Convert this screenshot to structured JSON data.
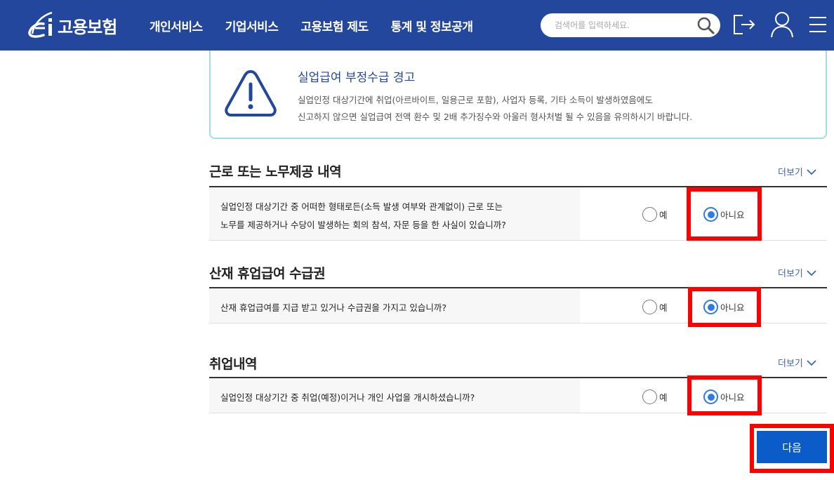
{
  "header": {
    "logo_text": "고용보험",
    "nav": [
      "개인서비스",
      "기업서비스",
      "고용보험 제도",
      "통계 및 정보공개"
    ],
    "search_placeholder": "검색어를 입력하세요.",
    "bg_color": "#23479c"
  },
  "alert": {
    "title": "실업급여 부정수급 경고",
    "line1": "실업인정 대상기간에 취업(아르바이트, 일용근로 포함), 사업자 등록, 기타 소득이 발생하였음에도",
    "line2": "신고하지 않으면 실업급여 전액 환수 및 2배 추가징수와 아울러 형사처벌 될 수 있음을 유의하시기 바랍니다."
  },
  "sections": [
    {
      "title": "근로 또는 노무제공 내역",
      "more": "더보기",
      "question_lines": [
        "실업인정 대상기간 중 어떠한 형태로든(소득 발생 여부와 관계없이) 근로 또는",
        "노무를 제공하거나 수당이 발생하는 회의 참석, 자문 등을 한 사실이 있습니까?"
      ],
      "yes": "예",
      "no": "아니요",
      "selected": "no"
    },
    {
      "title": "산재 휴업급여 수급권",
      "more": "더보기",
      "question_lines": [
        "산재 휴업급여를 지급 받고 있거나 수급권을 가지고 있습니까?"
      ],
      "yes": "예",
      "no": "아니요",
      "selected": "no"
    },
    {
      "title": "취업내역",
      "more": "더보기",
      "question_lines": [
        "실업인정 대상기간 중 취업(예정)이거나 개인 사업을 개시하셨습니까?"
      ],
      "yes": "예",
      "no": "아니요",
      "selected": "no"
    }
  ],
  "next_button": "다음",
  "colors": {
    "accent": "#2f7ae5",
    "highlight": "#ff0000",
    "button": "#0b5cc9"
  }
}
